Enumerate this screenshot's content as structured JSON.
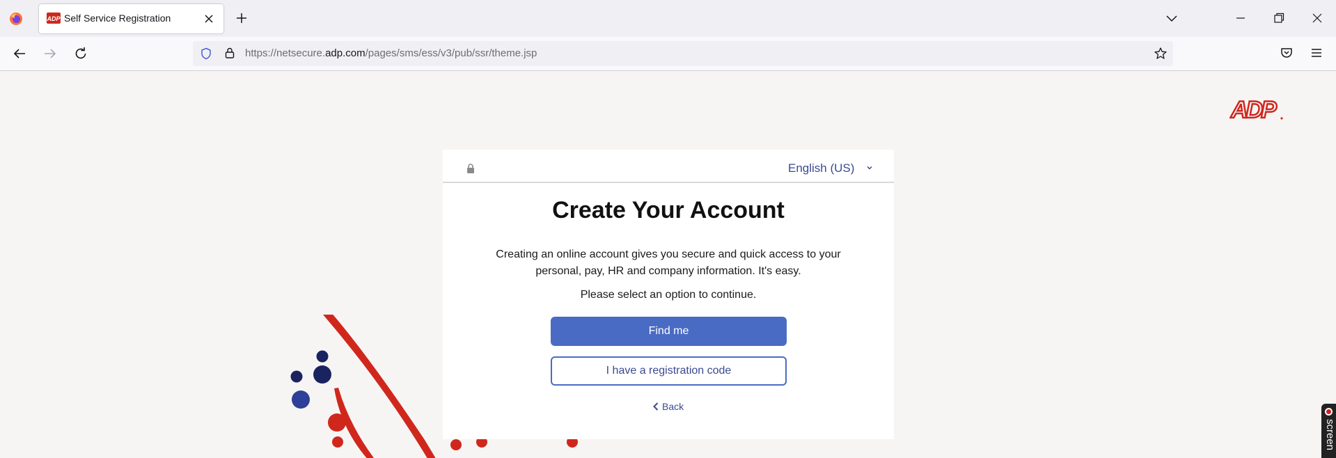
{
  "browser": {
    "tab": {
      "title": "Self Service Registration"
    },
    "url": {
      "prefix": "https://netsecure.",
      "domain": "adp.com",
      "path": "/pages/sms/ess/v3/pub/ssr/theme.jsp"
    }
  },
  "card": {
    "language": "English (US)",
    "title": "Create Your Account",
    "description": "Creating an online account gives you secure and quick access to your personal, pay, HR and company information. It's easy.",
    "prompt": "Please select an option to continue.",
    "primary_button": "Find me",
    "secondary_button": "I have a registration code",
    "back_link": "Back"
  },
  "overlay": {
    "screen_widget_label": "screen"
  },
  "colors": {
    "primary": "#4a6bc4",
    "link": "#3a4a8f",
    "adp_red": "#d0271d",
    "navy_dots": "#1a2360"
  }
}
